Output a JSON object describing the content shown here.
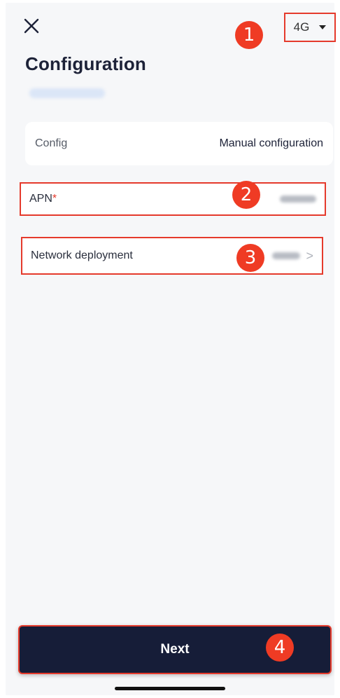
{
  "header": {
    "close_icon": "close-icon",
    "network_type": "4G",
    "title": "Configuration"
  },
  "config_card": {
    "label": "Config",
    "value": "Manual configuration"
  },
  "apn_row": {
    "label": "APN",
    "required_mark": "*"
  },
  "network_row": {
    "label": "Network deployment",
    "chevron": ">"
  },
  "annotations": [
    "1",
    "2",
    "3",
    "4"
  ],
  "footer": {
    "next_label": "Next"
  },
  "colors": {
    "highlight": "#e53a2c",
    "badge": "#ef3b24",
    "primary_button": "#161d38"
  }
}
